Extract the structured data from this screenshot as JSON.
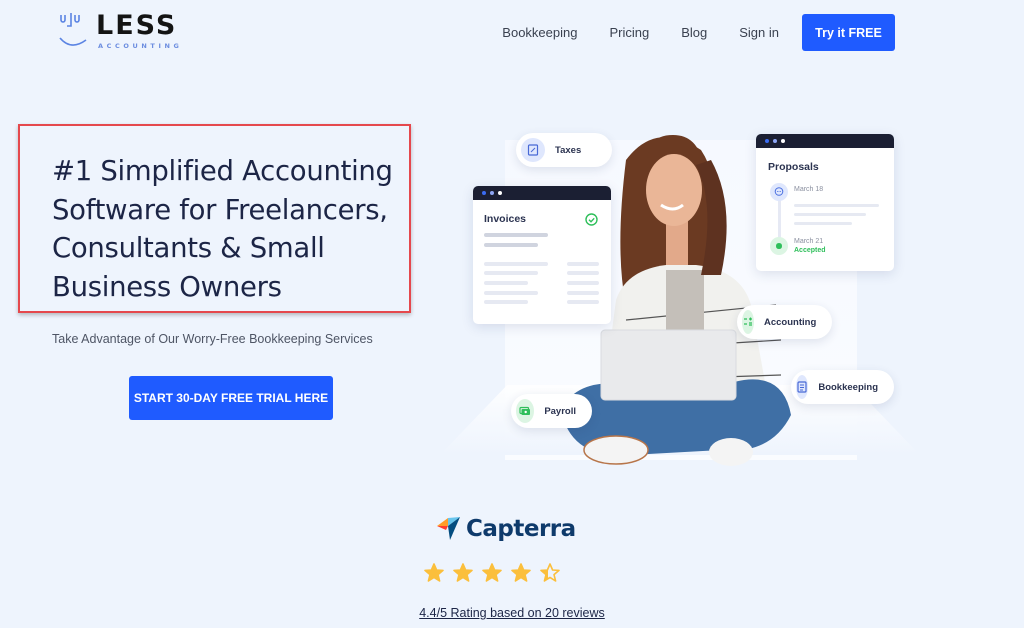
{
  "brand": {
    "name": "LESS",
    "tagline": "ACCOUNTING",
    "logo_icon": "smiley-face-logo-icon"
  },
  "nav": {
    "links": [
      "Bookkeeping",
      "Pricing",
      "Blog",
      "Sign in"
    ],
    "cta": "Try it FREE"
  },
  "hero": {
    "headline_lines": [
      "#1 Simplified Accounting",
      "Software for Freelancers,",
      "Consultants & Small",
      "Business Owners"
    ],
    "subtext": "Take Advantage of Our Worry-Free Bookkeeping Services",
    "cta": "START 30-DAY FREE TRIAL HERE"
  },
  "illustration": {
    "pills": {
      "taxes": {
        "label": "Taxes",
        "icon": "receipt-icon"
      },
      "accounting": {
        "label": "Accounting",
        "icon": "calculator-icon"
      },
      "bookkeeping": {
        "label": "Bookkeeping",
        "icon": "ledger-icon"
      },
      "payroll": {
        "label": "Payroll",
        "icon": "money-icon"
      }
    },
    "invoices_card": {
      "title": "Invoices",
      "icon": "check-circle-icon"
    },
    "proposals_card": {
      "title": "Proposals",
      "events": [
        {
          "date": "March 18",
          "icon": "chat-bubble-icon"
        },
        {
          "date": "March 21",
          "status": "Accepted",
          "icon": "clapping-hands-icon"
        }
      ]
    }
  },
  "review": {
    "provider": "Capterra",
    "rating": 4.4,
    "max_rating": 5,
    "rating_text": "4.4/5 Rating based on 20 reviews"
  },
  "colors": {
    "primary": "#1f5bff",
    "background": "#eef4fd",
    "heading": "#1c2546",
    "highlight_border": "#e5484d",
    "star": "#fbbf3c",
    "accepted": "#2fbf5b"
  }
}
